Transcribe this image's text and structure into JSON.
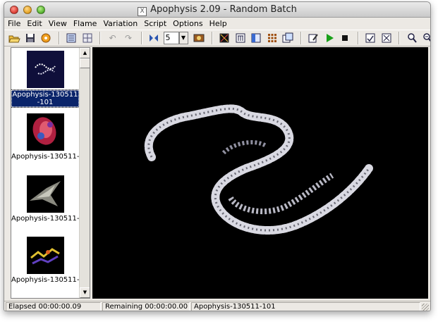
{
  "window": {
    "title": "Apophysis 2.09 - Random Batch",
    "app_icon": "apophysis-app-icon",
    "app_icon_glyph": "X"
  },
  "menu": [
    "File",
    "Edit",
    "View",
    "Flame",
    "Variation",
    "Script",
    "Options",
    "Help"
  ],
  "toolbar": {
    "icons": [
      "open-icon",
      "save-icon",
      "random-batch-icon",
      "list-view-icon",
      "icon-view-icon",
      "undo-icon",
      "redo-icon",
      "mutate-icon",
      "batch-count",
      "gradient-icon",
      "editor-icon",
      "transform-icon",
      "triangle-icon",
      "grid-icon",
      "render-all-icon",
      "edit-script-icon",
      "run-script-icon",
      "stop-script-icon",
      "options-icon",
      "fullscreen-icon",
      "zoom-in-icon",
      "zoom-out-icon",
      "pan-hand-icon",
      "rotate-icon"
    ],
    "batch_count": "5"
  },
  "thumbnails": [
    {
      "label": "Apophysis-130511-101",
      "selected": true
    },
    {
      "label": "Apophysis-130511-...",
      "selected": false
    },
    {
      "label": "Apophysis-130511-...",
      "selected": false
    },
    {
      "label": "Apophysis-130511-...",
      "selected": false
    }
  ],
  "status": {
    "elapsed": "Elapsed 00:00:00.09",
    "remaining": "Remaining 00:00:00.00",
    "name": "Apophysis-130511-101"
  },
  "colors": {
    "selection": "#0a246a",
    "canvas_bg": "#000000",
    "fractal_main": "#e6e6ec"
  }
}
